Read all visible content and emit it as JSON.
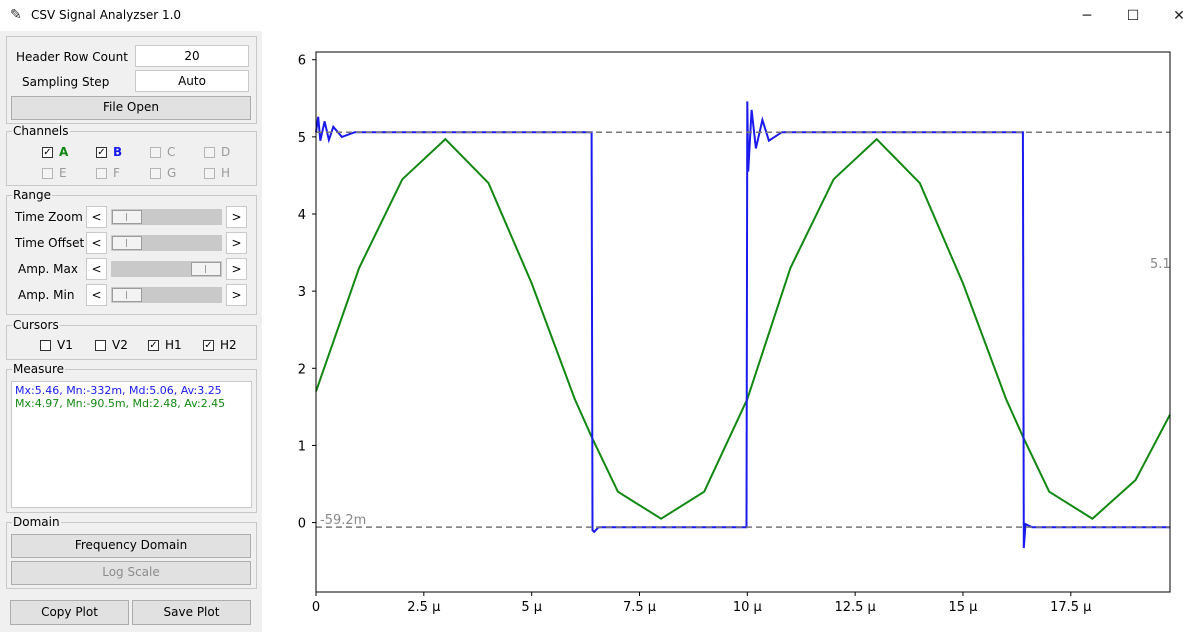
{
  "window": {
    "title": "CSV Signal Analyzser 1.0",
    "icon": "feather-icon"
  },
  "settings": {
    "header_row_label": "Header Row Count",
    "header_row_value": "20",
    "sampling_label": "Sampling Step",
    "sampling_value": "Auto",
    "file_open_label": "File Open"
  },
  "channels": {
    "legend": "Channels",
    "items": [
      {
        "label": "A",
        "checked": true,
        "enabled": true,
        "color": "#118811"
      },
      {
        "label": "B",
        "checked": true,
        "enabled": true,
        "color": "#1a1aee"
      },
      {
        "label": "C",
        "checked": false,
        "enabled": false
      },
      {
        "label": "D",
        "checked": false,
        "enabled": false
      },
      {
        "label": "E",
        "checked": false,
        "enabled": false
      },
      {
        "label": "F",
        "checked": false,
        "enabled": false
      },
      {
        "label": "G",
        "checked": false,
        "enabled": false
      },
      {
        "label": "H",
        "checked": false,
        "enabled": false
      }
    ]
  },
  "range": {
    "legend": "Range",
    "left_arrow": "<",
    "right_arrow": ">",
    "sliders": [
      {
        "label": "Time Zoom",
        "position": 0.12
      },
      {
        "label": "Time Offset",
        "position": 0.12
      },
      {
        "label": "Amp. Max",
        "position": 0.88
      },
      {
        "label": "Amp. Min",
        "position": 0.12
      }
    ]
  },
  "cursors": {
    "legend": "Cursors",
    "items": [
      {
        "label": "V1",
        "checked": false
      },
      {
        "label": "V2",
        "checked": false
      },
      {
        "label": "H1",
        "checked": true
      },
      {
        "label": "H2",
        "checked": true
      }
    ]
  },
  "measure": {
    "legend": "Measure",
    "lines": [
      {
        "text": "Mx:5.46,  Mn:-332m,  Md:5.06,  Av:3.25",
        "color": "#1a1aee"
      },
      {
        "text": "Mx:4.97,  Mn:-90.5m,  Md:2.48,  Av:2.45",
        "color": "#118811"
      }
    ]
  },
  "domain": {
    "legend": "Domain",
    "frequency_label": "Frequency Domain",
    "log_label": "Log Scale"
  },
  "actions": {
    "copy_label": "Copy Plot",
    "save_label": "Save Plot"
  },
  "chart_data": {
    "type": "line",
    "xlim": [
      0,
      19.8
    ],
    "ylim": [
      -0.9,
      6.1
    ],
    "x_ticks": [
      0,
      2.5,
      5,
      7.5,
      10,
      12.5,
      15,
      17.5
    ],
    "x_tick_labels": [
      "0",
      "2.5 µ",
      "5 µ",
      "7.5 µ",
      "10 µ",
      "12.5 µ",
      "15 µ",
      "17.5 µ"
    ],
    "y_ticks": [
      0,
      1,
      2,
      3,
      4,
      5,
      6
    ],
    "y_tick_labels": [
      "0",
      "1",
      "2",
      "3",
      "4",
      "5",
      "6"
    ],
    "grid": false,
    "cursor_lines": [
      {
        "name": "H1",
        "y": 5.06,
        "label": "5.1"
      },
      {
        "name": "H2",
        "y": -0.0592,
        "label": "-59.2m"
      }
    ],
    "series": [
      {
        "name": "A",
        "color": "#118811",
        "x": [
          0,
          1,
          2,
          3,
          4,
          5,
          6,
          6.4,
          7,
          8,
          9,
          10,
          11,
          12,
          13,
          14,
          15,
          16,
          16.4,
          17,
          18,
          19,
          19.8
        ],
        "y": [
          1.7,
          3.3,
          4.45,
          4.97,
          4.4,
          3.1,
          1.6,
          1.1,
          0.4,
          0.05,
          0.4,
          1.6,
          3.3,
          4.45,
          4.97,
          4.4,
          3.1,
          1.6,
          1.1,
          0.4,
          0.05,
          0.55,
          1.4
        ]
      },
      {
        "name": "B",
        "color": "#1a1aee",
        "x": [
          0,
          0.05,
          0.1,
          0.2,
          0.3,
          0.4,
          0.6,
          0.9,
          6.39,
          6.41,
          6.45,
          6.55,
          9.98,
          10.0,
          10.02,
          10.1,
          10.2,
          10.35,
          10.5,
          10.8,
          16.39,
          16.41,
          16.45,
          16.6,
          19.8
        ],
        "y": [
          5.06,
          5.26,
          4.95,
          5.2,
          4.96,
          5.13,
          5.0,
          5.06,
          5.06,
          -0.1,
          -0.12,
          -0.06,
          -0.06,
          5.46,
          4.55,
          5.35,
          4.85,
          5.22,
          4.95,
          5.06,
          5.06,
          -0.33,
          -0.02,
          -0.06,
          -0.06
        ]
      }
    ]
  }
}
